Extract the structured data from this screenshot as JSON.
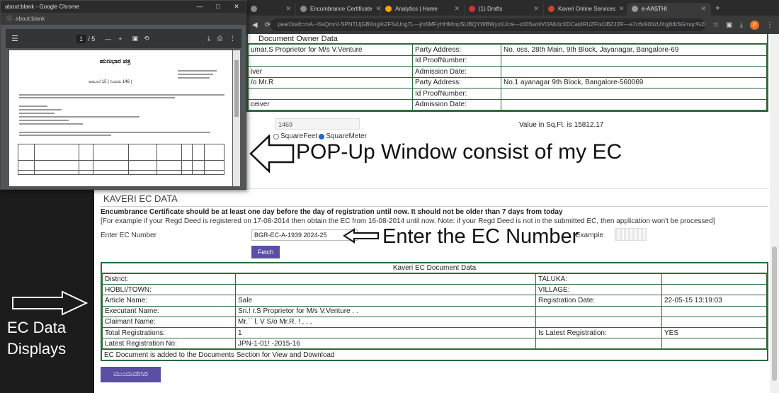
{
  "browser": {
    "tabs": [
      {
        "label": "",
        "color": "#8a8a8a",
        "active": false
      },
      {
        "label": "Encumbrance Certificate",
        "color": "#8a8a8a",
        "active": false
      },
      {
        "label": "Analytics | Home",
        "color": "#f4a300",
        "active": false
      },
      {
        "label": "(1) Drafts",
        "color": "#cc3333",
        "active": false
      },
      {
        "label": "Kaveri Online Services",
        "color": "#cc4422",
        "active": false
      },
      {
        "label": "e-AASTHI",
        "color": "#999999",
        "active": true
      }
    ],
    "url": "pearDraft=mA--\\5sQmrV-SPNTUjGBXng%2F5vUng7L—jm5MFyHHMmpSUBQYWBWyxKJcw—x00SwnlVOAK4cXDCatdRUZFtsOBZJ2R—a7c6x900zUXqj6tbSGmqc%2fm3lGo...",
    "profile_initial": "P"
  },
  "popup": {
    "window_title": "about:blank - Google Chrome",
    "url": "about:blank",
    "page_current": "1",
    "page_total": "/ 5",
    "doc_title": "ಋಣಭಾರ ಪತ್ರ",
    "doc_subtitle": "ಅಮೂನೆ 15 ( ನಿಯಮ 146 )"
  },
  "owner_table": {
    "title": "Document Owner Data",
    "rows": [
      [
        "umar.S Proprietor for M/s V.Venture",
        "Party Address:",
        "No.                         oss, 28th Main, 9th Block, Jayanagar, Bangalore-69"
      ],
      [
        "",
        "Id ProofNumber:",
        ""
      ],
      [
        "iver",
        "Admission Date:",
        ""
      ],
      [
        "/o Mr.R",
        "Party Address:",
        "No.1                       ayanagar 9th Block, Bangalore-560069"
      ],
      [
        "",
        "Id ProofNumber:",
        ""
      ],
      [
        "ceiver",
        "Admission Date:",
        ""
      ]
    ]
  },
  "area": {
    "value": "1469",
    "unit_feet": "SquareFeet",
    "unit_meter": "SquareMeter",
    "value_text": "Value in Sq.Ft. is 15812.17"
  },
  "kaveri": {
    "title": "KAVERI EC DATA",
    "note": "Encumbrance Certificate should be at least one day before the day of registration until now. It should not be older than 7 days from today",
    "example": "[For example if your Regd Deed is registered on 17-08-2014 then obtain the EC from 16-08-2014 until now. Note: if your Regd Deed is not in the submitted EC, then application won't be processed]",
    "ec_label": "Enter EC Number",
    "ec_value": "BGR-EC-A-1939     2024-25",
    "example_label": "Example",
    "fetch_label": "Fetch",
    "table_caption": "Kaveri EC Document Data",
    "rows": [
      [
        "District:",
        "",
        "TALUKA:",
        ""
      ],
      [
        "HOBLI/TOWN:",
        "",
        "VILLAGE:",
        ""
      ],
      [
        "Article Name:",
        "Sale",
        "Registration Date:",
        "22-05-15 13:19:03"
      ],
      [
        "Executant Name:",
        "Sri.!              r.S Proprietor for M/s V.Venture . .",
        "",
        ""
      ],
      [
        "Claimant Name:",
        "Mr.``     l. V S/o Mr.R.             ! , , ,",
        "",
        ""
      ],
      [
        "Total Registrations:",
        "1",
        "Is Latest Registration:",
        "YES"
      ],
      [
        "Latest Registration No:",
        "JPN-1-01!      -2015-16",
        "",
        ""
      ]
    ],
    "footer": "EC Document is added to the Documents Section for View and Download",
    "submit_label": "ಮುಂದುವರಿಸಿರಿ"
  },
  "annotations": {
    "popup": "POP-Up Window consist of my EC",
    "ec": "Enter the EC Number",
    "data_line1": "EC Data",
    "data_line2": "Displays"
  }
}
